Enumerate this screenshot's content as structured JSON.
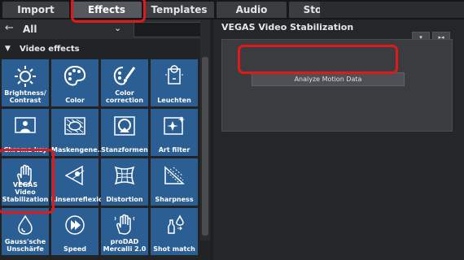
{
  "tabs": [
    {
      "label": "Import",
      "active": false
    },
    {
      "label": "Effects",
      "active": true
    },
    {
      "label": "Templates",
      "active": false
    },
    {
      "label": "Audio",
      "active": false
    },
    {
      "label": "Store",
      "active": false
    }
  ],
  "filter": {
    "label": "All",
    "back_icon": "arrow-left-icon",
    "chevron_icon": "chevron-down-icon"
  },
  "section": {
    "title": "Video effects",
    "toggle_icon": "triangle-down-icon"
  },
  "effects": [
    {
      "label": "Brightness/\nContrast",
      "icon": "sun-icon"
    },
    {
      "label": "Color",
      "icon": "palette-icon"
    },
    {
      "label": "Color\ncorrection",
      "icon": "palette-brush-icon"
    },
    {
      "label": "Leuchten",
      "icon": "lamp-icon"
    },
    {
      "label": "Chroma key",
      "icon": "person-screen-icon"
    },
    {
      "label": "Maskengene...",
      "icon": "mask-pattern-icon"
    },
    {
      "label": "Stanzformen",
      "icon": "shape-cut-icon"
    },
    {
      "label": "Art filter",
      "icon": "sparkle-frame-icon"
    },
    {
      "label": "VEGAS Video\nStabilization",
      "icon": "hand-icon"
    },
    {
      "label": "Linsenreflexion",
      "icon": "lens-flare-icon"
    },
    {
      "label": "Distortion",
      "icon": "grid-distort-icon"
    },
    {
      "label": "Sharpness",
      "icon": "sharpness-icon"
    },
    {
      "label": "Gauss'sche\nUnschärfe",
      "icon": "droplet-icon"
    },
    {
      "label": "Speed",
      "icon": "speed-icon"
    },
    {
      "label": "proDAD\nMercalli 2.0",
      "icon": "hand-icon"
    },
    {
      "label": "Shot match",
      "icon": "color-match-icon"
    }
  ],
  "panel": {
    "title": "VEGAS Video Stabilization",
    "analyze_label": "Analyze Motion Data",
    "buttons": [
      {
        "icon": "chevron-down-icon",
        "glyph": "▾"
      },
      {
        "icon": "expand-icon",
        "glyph": "▸◂"
      }
    ]
  },
  "colors": {
    "tile": "#2b5f93",
    "highlight": "#e01a1a",
    "accent": "#ffffff"
  }
}
